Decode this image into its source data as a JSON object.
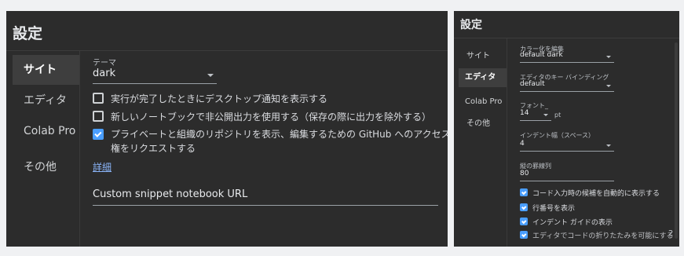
{
  "left_dialog": {
    "title": "設定",
    "nav": [
      "サイト",
      "エディタ",
      "Colab Pro",
      "その他"
    ],
    "theme_label": "テーマ",
    "theme_value": "dark",
    "checkboxes": [
      {
        "label": "実行が完了したときにデスクトップ通知を表示する",
        "checked": false
      },
      {
        "label": "新しいノートブックで非公開出力を使用する（保存の際に出力を除外する）",
        "checked": false
      },
      {
        "label_line1": "プライベートと組織のリポジトリを表示、編集するための GitHub へのアクセス",
        "label_line2": "権をリクエストする",
        "checked": true
      }
    ],
    "details_link": "詳細",
    "snippet_url_label": "Custom snippet notebook URL"
  },
  "right_dialog": {
    "title": "設定",
    "nav": [
      "サイト",
      "エディタ",
      "Colab Pro",
      "その他"
    ],
    "colorize_label": "カラー化を編集",
    "colorize_value": "default dark",
    "keybinding_label": "エディタのキー バインディング",
    "keybinding_value": "default",
    "font_label": "フォント_",
    "font_value": "14",
    "font_unit": "pt",
    "indent_label": "インデント幅（スペース）",
    "indent_value": "4",
    "ruler_label": "縦の罫線列",
    "ruler_value": "80",
    "checkboxes": [
      {
        "label": "コード入力時の候補を自動的に表示する",
        "checked": true
      },
      {
        "label": "行番号を表示",
        "checked": true
      },
      {
        "label": "インデント ガイドの表示",
        "checked": true
      },
      {
        "label": "エディタでコードの折りたたみを可能にする",
        "checked": true
      }
    ],
    "page_number": "2"
  },
  "colors": {
    "panel": "#2c2c2c",
    "accent": "#4a9eff",
    "link": "#8ab4f8",
    "text": "#e8eaed"
  }
}
